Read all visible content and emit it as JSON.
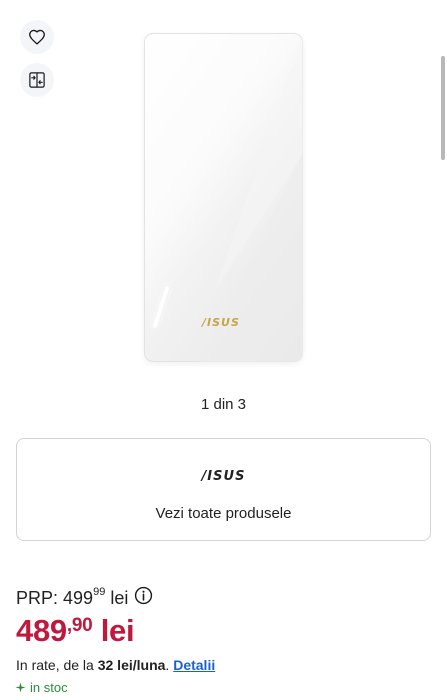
{
  "gallery": {
    "counter": "1 din 3",
    "device_brand": "/ISUS"
  },
  "actions": [
    {
      "icon": "heart-icon"
    },
    {
      "icon": "compare-icon"
    }
  ],
  "brand_card": {
    "logo_text": "/ISUS",
    "cta_label": "Vezi toate produsele"
  },
  "pricing": {
    "prp_label": "PRP:",
    "prp_int": "499",
    "prp_dec": "99",
    "prp_currency": "lei",
    "price_int": "489",
    "price_dec": "90",
    "price_currency": "lei",
    "installment_prefix": "In rate, de la",
    "installment_amount": "32 lei/luna",
    "installment_suffix": ".",
    "details_link": "Detalii"
  },
  "stock": {
    "label": "in stoc"
  },
  "colors": {
    "price_red": "#c0193e",
    "link_blue": "#1a61c9",
    "stock_green": "#2e8b3a",
    "brand_gold": "#c7a44a"
  }
}
